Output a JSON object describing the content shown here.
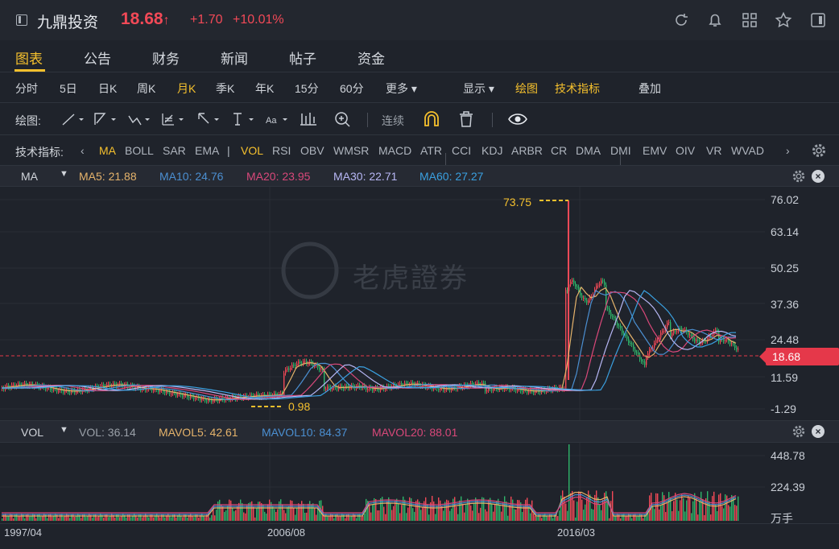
{
  "header": {
    "title": "九鼎投资",
    "price": "18.68",
    "price_arrow": "↑",
    "change": "+1.70",
    "change_pct": "+10.01%"
  },
  "tabs": [
    "图表",
    "公告",
    "财务",
    "新闻",
    "帖子",
    "资金"
  ],
  "periods": [
    "分时",
    "5日",
    "日K",
    "周K",
    "月K",
    "季K",
    "年K",
    "15分",
    "60分",
    "更多"
  ],
  "period_active": "月K",
  "period_tools": {
    "show": "显示",
    "draw": "绘图",
    "indicators": "技术指标",
    "overlay": "叠加"
  },
  "draw_toolbar": {
    "label": "绘图:",
    "continuous": "连续"
  },
  "indicators": {
    "label": "技术指标:",
    "items": [
      "MA",
      "BOLL",
      "SAR",
      "EMA",
      "VOL",
      "RSI",
      "OBV",
      "WMSR",
      "MACD",
      "ATR",
      "CCI",
      "KDJ",
      "ARBR",
      "CR",
      "DMA",
      "DMI",
      "EMV",
      "OIV",
      "VR",
      "WVAD"
    ],
    "separator": "|"
  },
  "ma_panel": {
    "name": "MA",
    "values": [
      {
        "label": "MA5: 21.88",
        "color": "#e5b36b"
      },
      {
        "label": "MA10: 24.76",
        "color": "#4b8fd1"
      },
      {
        "label": "MA20: 23.95",
        "color": "#d9487a"
      },
      {
        "label": "MA30: 22.71",
        "color": "#b7b7f5"
      },
      {
        "label": "MA60: 27.27",
        "color": "#3aa0e0"
      }
    ]
  },
  "vol_panel": {
    "name": "VOL",
    "values": [
      {
        "label": "VOL: 36.14",
        "color": "#9aa0a8"
      },
      {
        "label": "MAVOL5: 42.61",
        "color": "#e5b36b"
      },
      {
        "label": "MAVOL10: 84.37",
        "color": "#4b8fd1"
      },
      {
        "label": "MAVOL20: 88.01",
        "color": "#d9487a"
      }
    ],
    "unit": "万手"
  },
  "price_axis": [
    "76.02",
    "63.14",
    "50.25",
    "37.36",
    "24.48",
    "11.59",
    "-1.29"
  ],
  "vol_axis": [
    "448.78",
    "224.39"
  ],
  "last_price": "18.68",
  "annotations": {
    "high": "73.75",
    "low": "0.98"
  },
  "dates": [
    "1997/04",
    "2006/08",
    "2016/03"
  ],
  "watermark": "老虎證券",
  "colors": {
    "up": "#f24957",
    "down": "#2fb56a",
    "accent": "#f5c02d",
    "bg": "#1f232b"
  }
}
